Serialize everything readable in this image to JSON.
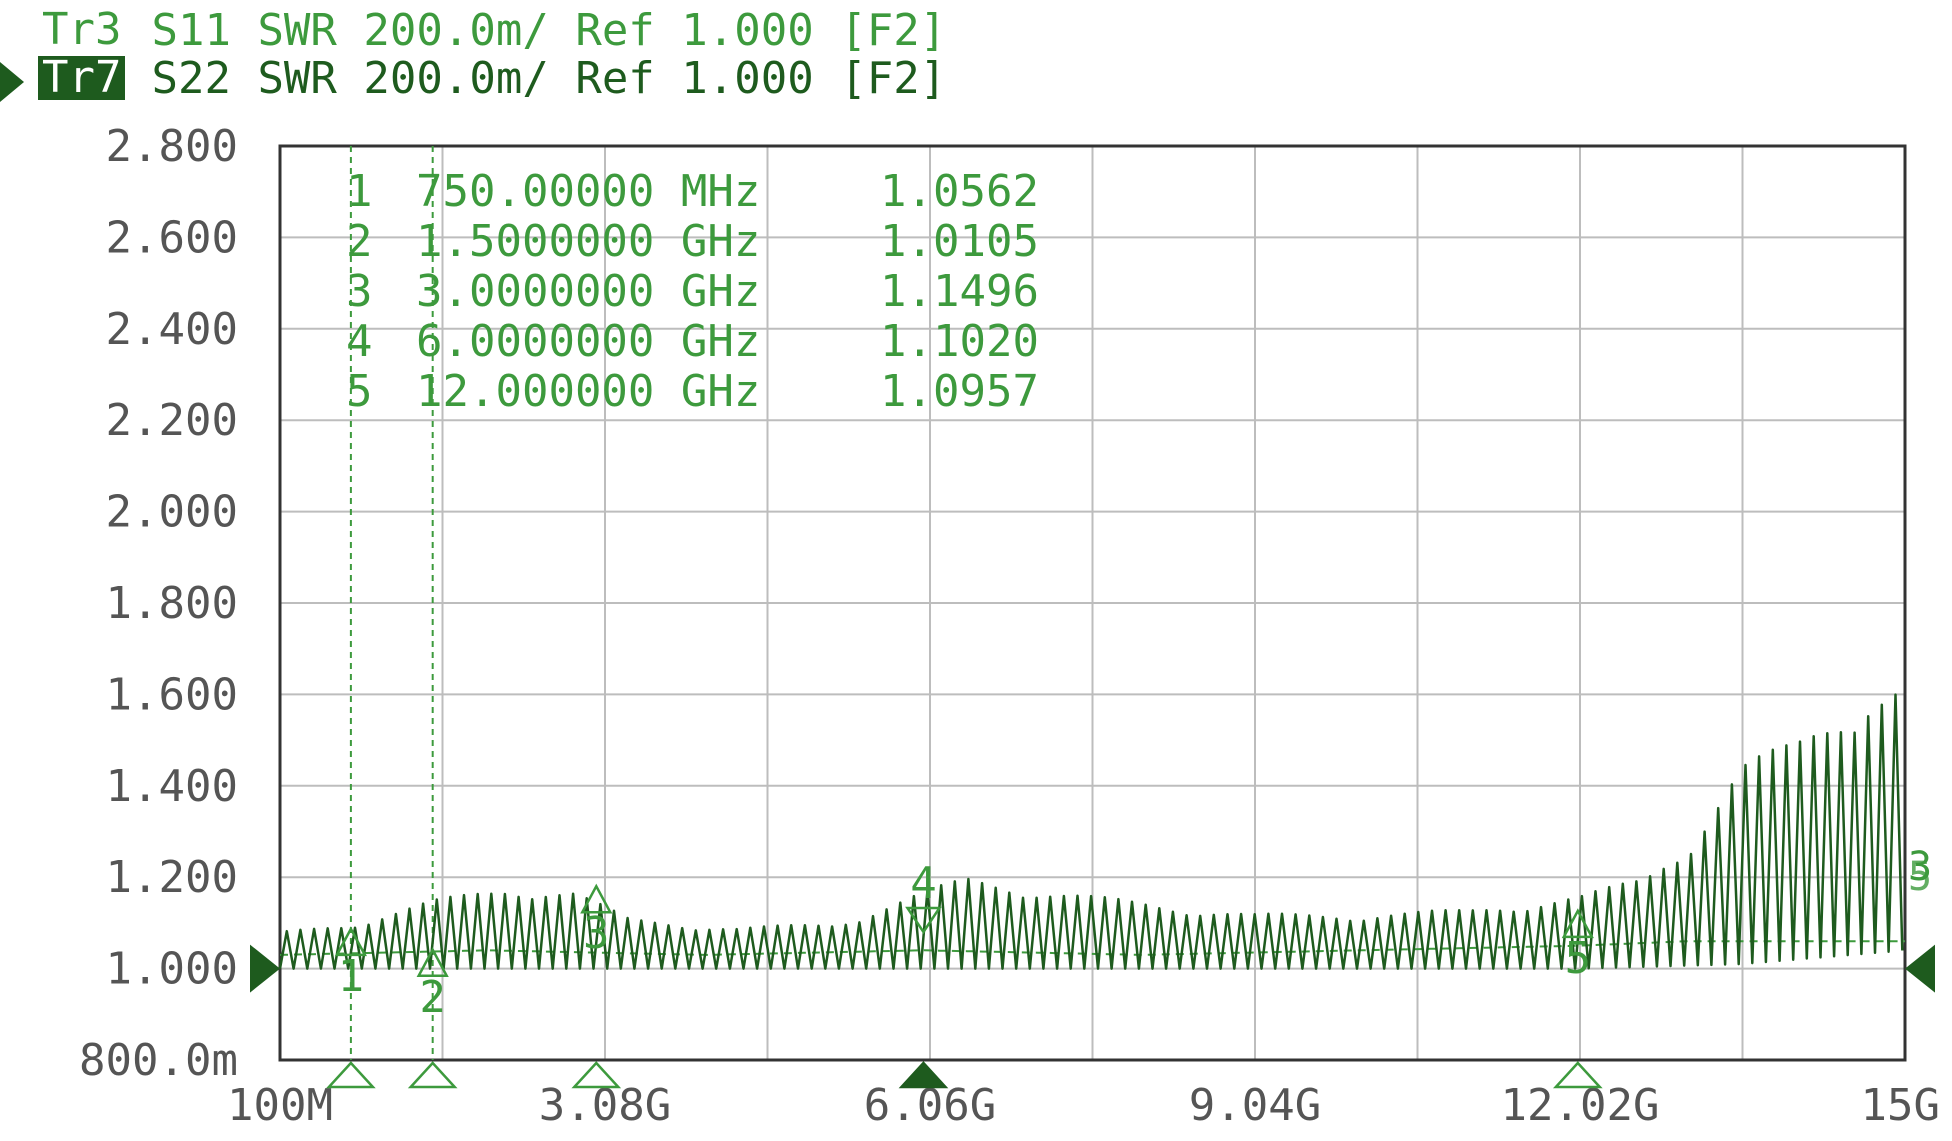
{
  "header": {
    "traces": [
      {
        "label": "Tr3",
        "text": "S11 SWR 200.0m/ Ref 1.000 [F2]",
        "active": false,
        "color": "#3d9a3d"
      },
      {
        "label": "Tr7",
        "text": "S22 SWR 200.0m/ Ref 1.000 [F2]",
        "active": true,
        "color": "#1e5b1e"
      }
    ]
  },
  "colors": {
    "grid": "#bdbdbd",
    "frame": "#333333",
    "tick_text": "#555555",
    "s22": "#1e5b1e",
    "s11": "#3d9a3d",
    "marker_text": "#3d9a3d"
  },
  "chart_data": {
    "type": "line",
    "title": "",
    "xlabel": "",
    "ylabel": "",
    "xlim": [
      0.1,
      15.0
    ],
    "ylim": [
      0.8,
      2.8
    ],
    "x_unit": "GHz",
    "x_tick_values": [
      0.1,
      3.08,
      6.06,
      9.04,
      12.02,
      15.0
    ],
    "x_tick_labels": [
      "100M",
      "3.08G",
      "6.06G",
      "9.04G",
      "12.02G",
      "15G"
    ],
    "x_grid_divisions": 10,
    "y_ticks": [
      {
        "value": 2.8,
        "label": "2.800"
      },
      {
        "value": 2.6,
        "label": "2.600"
      },
      {
        "value": 2.4,
        "label": "2.400"
      },
      {
        "value": 2.2,
        "label": "2.200"
      },
      {
        "value": 2.0,
        "label": "2.000"
      },
      {
        "value": 1.8,
        "label": "1.800"
      },
      {
        "value": 1.6,
        "label": "1.600"
      },
      {
        "value": 1.4,
        "label": "1.400"
      },
      {
        "value": 1.2,
        "label": "1.200"
      },
      {
        "value": 1.0,
        "label": "1.000"
      },
      {
        "value": 0.8,
        "label": "800.0m"
      }
    ],
    "reference_level": 1.0,
    "grid": true,
    "series": [
      {
        "name": "S11",
        "color": "#3d9a3d",
        "x": [
          0.1,
          2.0,
          4.0,
          6.0,
          8.0,
          10.0,
          12.0,
          13.0,
          14.0,
          15.0
        ],
        "y": [
          1.03,
          1.04,
          1.03,
          1.04,
          1.03,
          1.04,
          1.05,
          1.06,
          1.06,
          1.06
        ]
      },
      {
        "name": "S22",
        "color": "#1e5b1e",
        "ripple_period_ghz": 0.125,
        "min_envelope": {
          "x": [
            0.1,
            3.0,
            6.0,
            9.0,
            12.0,
            13.5,
            15.0
          ],
          "y": [
            1.0,
            1.0,
            1.0,
            1.0,
            1.0,
            1.01,
            1.04
          ]
        },
        "peak_envelope": {
          "x": [
            0.1,
            0.75,
            1.5,
            2.2,
            2.8,
            3.3,
            4.3,
            5.2,
            6.0,
            6.4,
            7.2,
            8.2,
            9.04,
            10.0,
            11.0,
            12.02,
            12.6,
            13.0,
            13.5,
            14.0,
            14.6,
            15.0
          ],
          "y": [
            1.08,
            1.1,
            1.15,
            1.18,
            1.17,
            1.11,
            1.09,
            1.1,
            1.17,
            1.2,
            1.17,
            1.14,
            1.12,
            1.12,
            1.13,
            1.16,
            1.2,
            1.28,
            1.45,
            1.5,
            1.62,
            1.63
          ]
        }
      }
    ],
    "marker_table": [
      {
        "num": "1",
        "freq": "750.00000 MHz",
        "value": "1.0562"
      },
      {
        "num": "2",
        "freq": "1.5000000 GHz",
        "value": "1.0105"
      },
      {
        "num": "3",
        "freq": "3.0000000 GHz",
        "value": "1.1496"
      },
      {
        "num": "4",
        "freq": "6.0000000 GHz",
        "value": "1.1020"
      },
      {
        "num": "5",
        "freq": "12.000000 GHz",
        "value": "1.0957"
      }
    ],
    "markers": [
      {
        "num": "1",
        "x": 0.75,
        "y": 1.0562,
        "vline": true,
        "label_pos": "below",
        "active": false
      },
      {
        "num": "2",
        "x": 1.5,
        "y": 1.0105,
        "vline": true,
        "label_pos": "below",
        "active": false
      },
      {
        "num": "3",
        "x": 3.0,
        "y": 1.1496,
        "vline": false,
        "label_pos": "below",
        "active": false
      },
      {
        "num": "4",
        "x": 6.0,
        "y": 1.102,
        "vline": false,
        "label_pos": "above",
        "active": true
      },
      {
        "num": "5",
        "x": 12.0,
        "y": 1.0957,
        "vline": false,
        "label_pos": "below",
        "active": false
      }
    ],
    "bottom_markers_x": [
      0.75,
      1.5,
      3.0,
      6.0,
      12.0
    ],
    "active_marker_x": 6.0,
    "right_edge_markers": [
      "3",
      "5"
    ]
  }
}
